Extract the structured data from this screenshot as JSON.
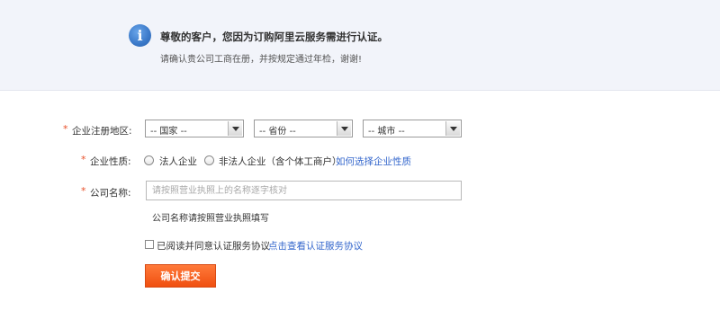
{
  "notice": {
    "icon": "info-icon",
    "icon_glyph": "i",
    "title": "尊敬的客户，您因为订购阿里云服务需进行认证。",
    "subtitle": "请确认贵公司工商在册，并按规定通过年检，谢谢!"
  },
  "form": {
    "required_mark": "*",
    "region": {
      "label": "企业注册地区:",
      "country": "-- 国家 --",
      "province": "-- 省份 --",
      "city": "-- 城市 --"
    },
    "nature": {
      "label": "企业性质:",
      "option_legal": "法人企业",
      "option_non_legal": "非法人企业（含个体工商户）",
      "help_link": "如何选择企业性质"
    },
    "company": {
      "label": "公司名称:",
      "placeholder": "请按照营业执照上的名称逐字核对",
      "value": "",
      "hint": "公司名称请按照营业执照填写"
    },
    "agreement": {
      "label": "已阅读并同意认证服务协议",
      "link": "点击查看认证服务协议",
      "checked": false
    },
    "submit_label": "确认提交"
  },
  "colors": {
    "accent_button": "#f25a1a",
    "link": "#3366cc",
    "required": "#e8502a",
    "notice_bg": "#f2f4fa",
    "info_icon": "#3d7fd0"
  }
}
